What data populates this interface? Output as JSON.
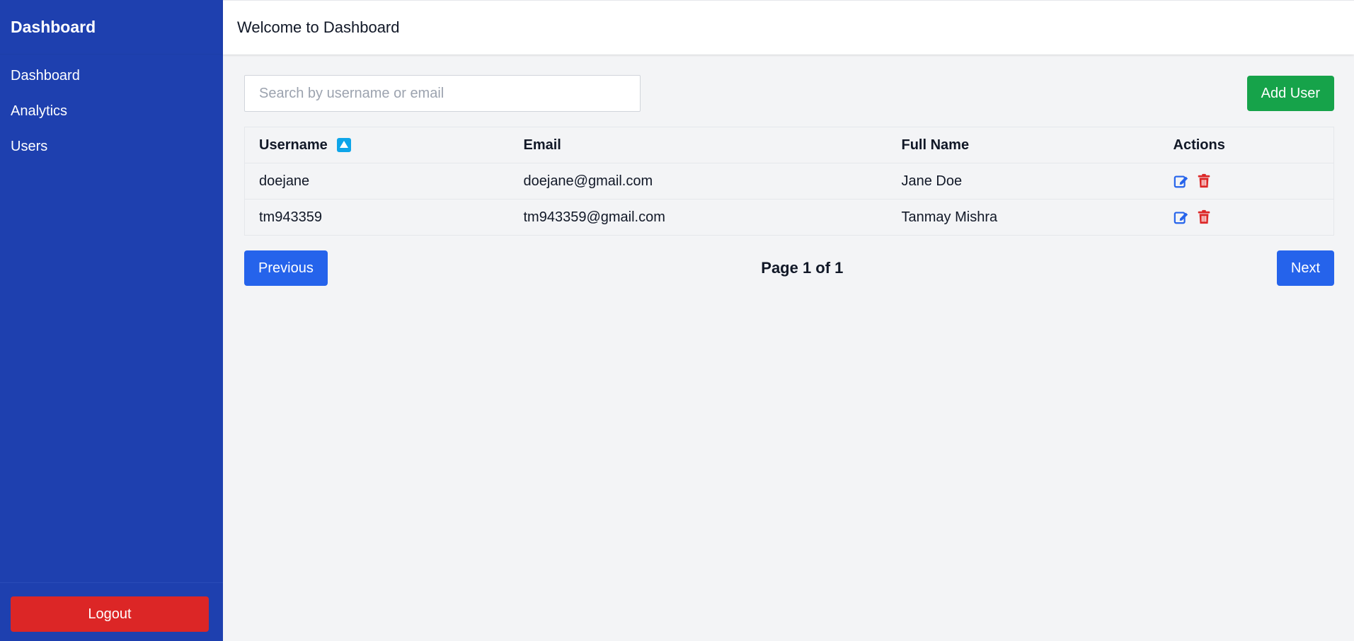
{
  "sidebar": {
    "brand": "Dashboard",
    "items": [
      {
        "label": "Dashboard"
      },
      {
        "label": "Analytics"
      },
      {
        "label": "Users"
      }
    ],
    "logout_label": "Logout"
  },
  "header": {
    "title": "Welcome to Dashboard"
  },
  "toolbar": {
    "search_placeholder": "Search by username or email",
    "search_value": "",
    "add_user_label": "Add User"
  },
  "table": {
    "headers": [
      "Username",
      "Email",
      "Full Name",
      "Actions"
    ],
    "sort": {
      "column": "Username",
      "direction": "ascending"
    },
    "rows": [
      {
        "username": "doejane",
        "email": "doejane@gmail.com",
        "full_name": "Jane Doe"
      },
      {
        "username": "tm943359",
        "email": "tm943359@gmail.com",
        "full_name": "Tanmay Mishra"
      }
    ]
  },
  "pagination": {
    "previous_label": "Previous",
    "page_text": "Page 1 of 1",
    "next_label": "Next"
  },
  "colors": {
    "sidebar_bg": "#1e40af",
    "add_button": "#16a34a",
    "page_button": "#2563eb",
    "logout_button": "#dc2626",
    "edit_icon": "#2563eb",
    "delete_icon": "#dc2626"
  },
  "icons": {
    "sort": "sort-ascending-icon",
    "edit": "edit-icon",
    "delete": "trash-icon"
  }
}
